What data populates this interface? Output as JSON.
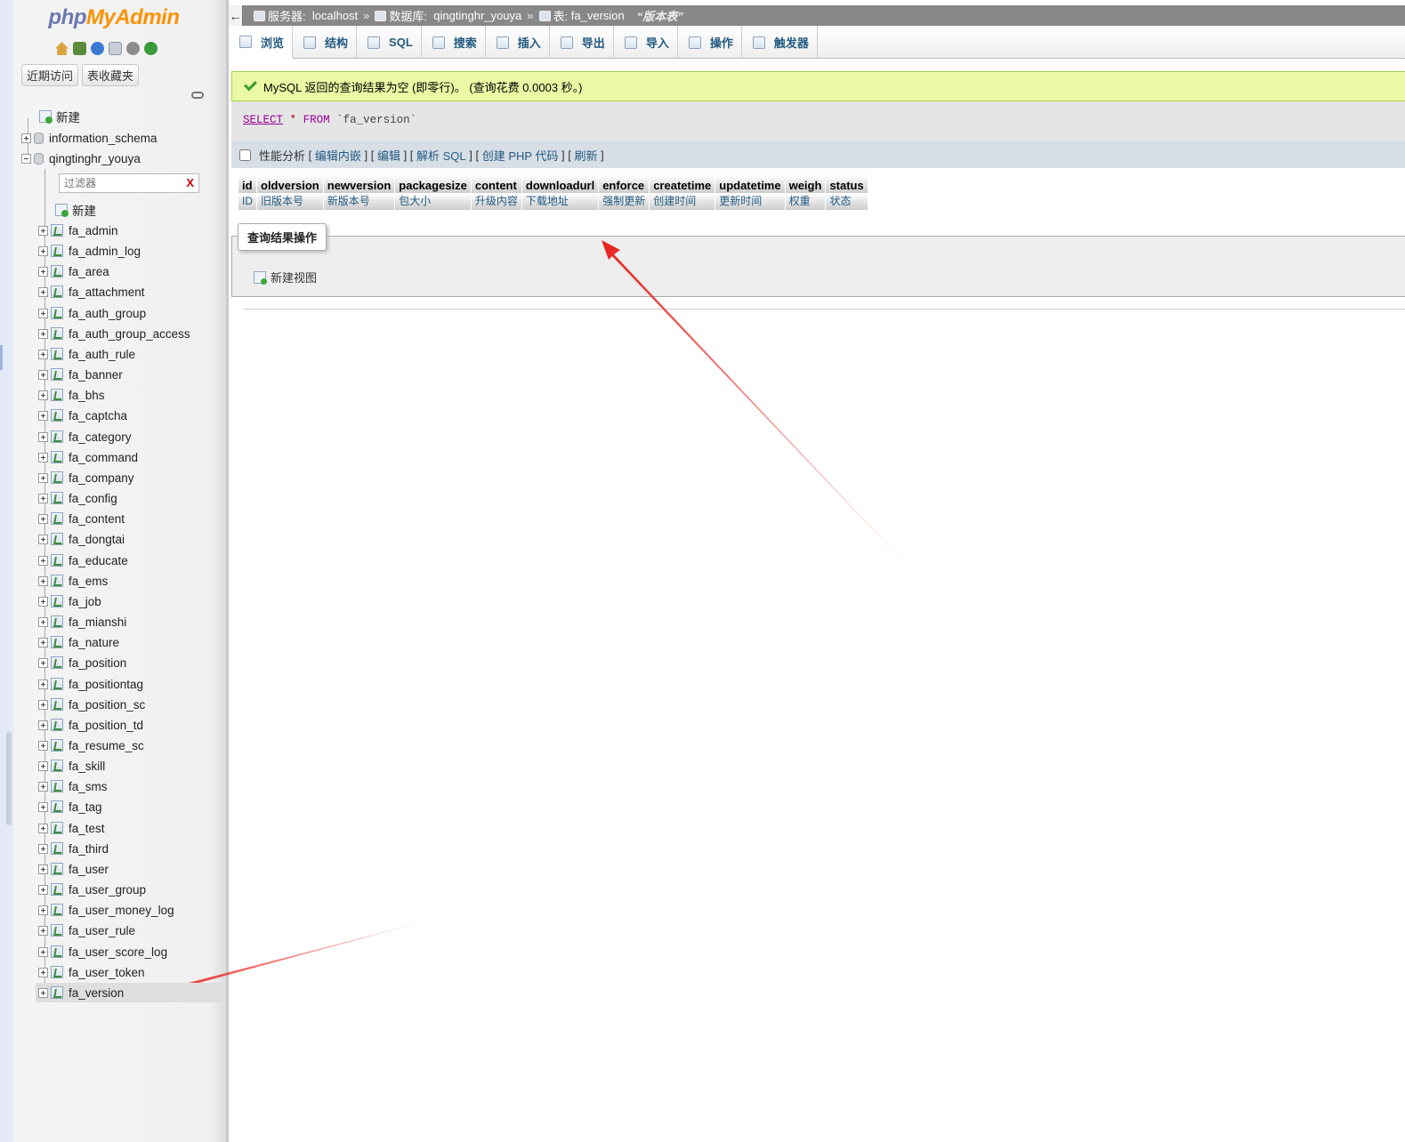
{
  "logo": {
    "part1": "php",
    "part2": "MyAdmin"
  },
  "quick_icons": [
    "home-icon",
    "exit-icon",
    "help-icon",
    "docs-icon",
    "settings-icon",
    "reload-icon"
  ],
  "nav_tabs": [
    "近期访问",
    "表收藏夹"
  ],
  "tree": {
    "new_label": "新建",
    "databases": [
      "information_schema",
      "qingtinghr_youya"
    ],
    "filter_placeholder": "过滤器",
    "filter_clear": "X",
    "db_new_label": "新建",
    "tables": [
      "fa_admin",
      "fa_admin_log",
      "fa_area",
      "fa_attachment",
      "fa_auth_group",
      "fa_auth_group_access",
      "fa_auth_rule",
      "fa_banner",
      "fa_bhs",
      "fa_captcha",
      "fa_category",
      "fa_command",
      "fa_company",
      "fa_config",
      "fa_content",
      "fa_dongtai",
      "fa_educate",
      "fa_ems",
      "fa_job",
      "fa_mianshi",
      "fa_nature",
      "fa_position",
      "fa_positiontag",
      "fa_position_sc",
      "fa_position_td",
      "fa_resume_sc",
      "fa_skill",
      "fa_sms",
      "fa_tag",
      "fa_test",
      "fa_third",
      "fa_user",
      "fa_user_group",
      "fa_user_money_log",
      "fa_user_rule",
      "fa_user_score_log",
      "fa_user_token",
      "fa_version"
    ],
    "selected_table": "fa_version"
  },
  "breadcrumb": {
    "back": "←",
    "server_label": "服务器:",
    "server": "localhost",
    "db_label": "数据库:",
    "db": "qingtinghr_youya",
    "table_label": "表:",
    "table": "fa_version",
    "comment": "“版本表”",
    "sep": "»"
  },
  "tabs": [
    {
      "label": "浏览",
      "icon": "browse-icon"
    },
    {
      "label": "结构",
      "icon": "structure-icon"
    },
    {
      "label": "SQL",
      "icon": "sql-icon"
    },
    {
      "label": "搜索",
      "icon": "search-icon"
    },
    {
      "label": "插入",
      "icon": "insert-icon"
    },
    {
      "label": "导出",
      "icon": "export-icon"
    },
    {
      "label": "导入",
      "icon": "import-icon"
    },
    {
      "label": "操作",
      "icon": "operations-icon"
    },
    {
      "label": "触发器",
      "icon": "triggers-icon"
    }
  ],
  "message": "MySQL 返回的查询结果为空 (即零行)。 (查询花费 0.0003 秒。)",
  "sql": {
    "select": "SELECT",
    "star": "*",
    "from": "FROM",
    "table": "`fa_version`"
  },
  "sql_ops": {
    "profiling": "性能分析",
    "links": [
      "编辑内嵌",
      "编辑",
      "解析 SQL",
      "创建 PHP 代码",
      "刷新"
    ]
  },
  "columns": [
    {
      "name": "id",
      "comment": "ID"
    },
    {
      "name": "oldversion",
      "comment": "旧版本号"
    },
    {
      "name": "newversion",
      "comment": "新版本号"
    },
    {
      "name": "packagesize",
      "comment": "包大小"
    },
    {
      "name": "content",
      "comment": "升级内容"
    },
    {
      "name": "downloadurl",
      "comment": "下载地址"
    },
    {
      "name": "enforce",
      "comment": "强制更新"
    },
    {
      "name": "createtime",
      "comment": "创建时间"
    },
    {
      "name": "updatetime",
      "comment": "更新时间"
    },
    {
      "name": "weigh",
      "comment": "权重"
    },
    {
      "name": "status",
      "comment": "状态"
    }
  ],
  "query_ops": {
    "legend": "查询结果操作",
    "new_view": "新建视图"
  },
  "colors": {
    "accent": "#235a81",
    "success_bg": "#ebf8a4",
    "arrow": "#e8231e"
  }
}
